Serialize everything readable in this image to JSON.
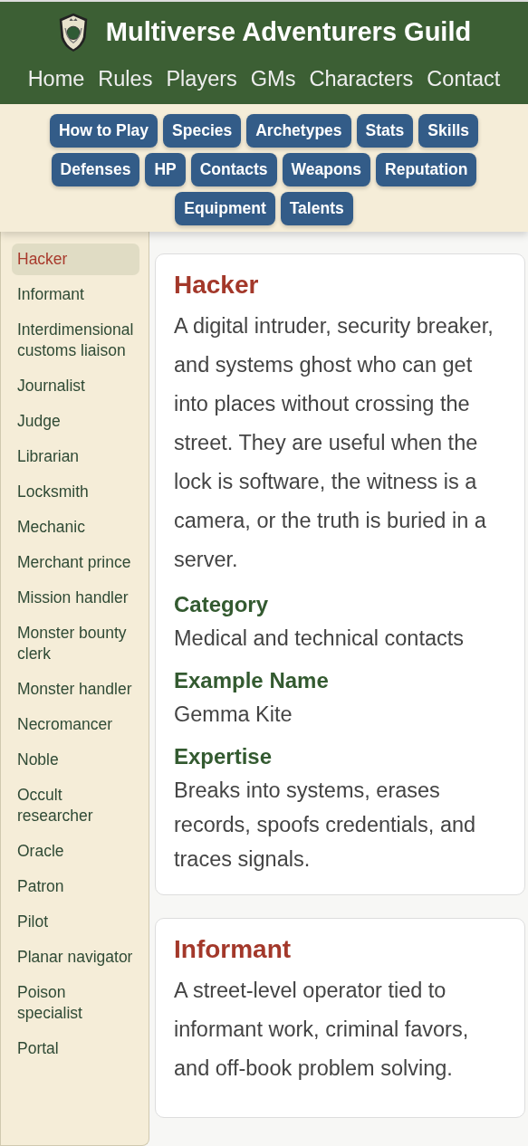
{
  "site": {
    "title": "Multiverse Adventurers Guild"
  },
  "main_nav": [
    {
      "label": "Home"
    },
    {
      "label": "Rules"
    },
    {
      "label": "Players"
    },
    {
      "label": "GMs"
    },
    {
      "label": "Characters"
    },
    {
      "label": "Contact"
    }
  ],
  "section_nav": [
    {
      "label": "How to Play"
    },
    {
      "label": "Species"
    },
    {
      "label": "Archetypes"
    },
    {
      "label": "Stats"
    },
    {
      "label": "Skills"
    },
    {
      "label": "Defenses"
    },
    {
      "label": "HP"
    },
    {
      "label": "Contacts"
    },
    {
      "label": "Weapons"
    },
    {
      "label": "Reputation"
    },
    {
      "label": "Equipment"
    },
    {
      "label": "Talents"
    }
  ],
  "sidebar": {
    "items": [
      {
        "label": "Hacker",
        "selected": true
      },
      {
        "label": "Informant",
        "selected": false
      },
      {
        "label": "Interdimensional customs liaison",
        "selected": false
      },
      {
        "label": "Journalist",
        "selected": false
      },
      {
        "label": "Judge",
        "selected": false
      },
      {
        "label": "Librarian",
        "selected": false
      },
      {
        "label": "Locksmith",
        "selected": false
      },
      {
        "label": "Mechanic",
        "selected": false
      },
      {
        "label": "Merchant prince",
        "selected": false
      },
      {
        "label": "Mission handler",
        "selected": false
      },
      {
        "label": "Monster bounty clerk",
        "selected": false
      },
      {
        "label": "Monster handler",
        "selected": false
      },
      {
        "label": "Necromancer",
        "selected": false
      },
      {
        "label": "Noble",
        "selected": false
      },
      {
        "label": "Occult researcher",
        "selected": false
      },
      {
        "label": "Oracle",
        "selected": false
      },
      {
        "label": "Patron",
        "selected": false
      },
      {
        "label": "Pilot",
        "selected": false
      },
      {
        "label": "Planar navigator",
        "selected": false
      },
      {
        "label": "Poison specialist",
        "selected": false
      },
      {
        "label": "Portal",
        "selected": false
      }
    ]
  },
  "cards": [
    {
      "title": "Hacker",
      "description": "A digital intruder, security breaker, and systems ghost who can get into places without crossing the street. They are useful when the lock is software, the witness is a camera, or the truth is buried in a server.",
      "fields": [
        {
          "label": "Category",
          "value": "Medical and technical contacts"
        },
        {
          "label": "Example Name",
          "value": "Gemma Kite"
        },
        {
          "label": "Expertise",
          "value": "Breaks into systems, erases records, spoofs credentials, and traces signals."
        }
      ]
    },
    {
      "title": "Informant",
      "description": "A street-level operator tied to informant work, criminal favors, and off-book problem solving."
    }
  ]
}
